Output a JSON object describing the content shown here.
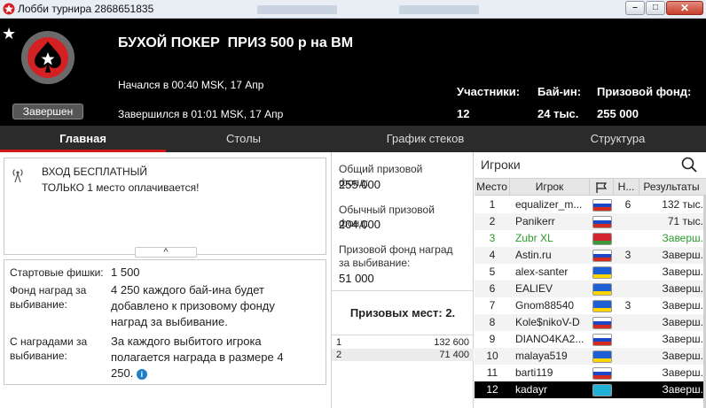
{
  "window": {
    "title": "Лобби турнира 2868651835",
    "controls": {
      "minimize": "–",
      "maximize": "□",
      "close": "✕"
    }
  },
  "header": {
    "star": "★",
    "status": "Завершен",
    "name": "БУХОЙ ПОКЕР  ПРИЗ 500 р на ВМ",
    "started": "Начался в 00:40 MSK, 17 Апр",
    "ended": "Завершился в 01:01 MSK, 17 Апр",
    "stats": [
      {
        "label": "Участники:",
        "value": "12"
      },
      {
        "label": "Бай-ин:",
        "value": "24 тыс."
      },
      {
        "label": "Призовой фонд:",
        "value": "255 000"
      }
    ]
  },
  "tabs": [
    {
      "label": "Главная",
      "active": true
    },
    {
      "label": "Столы",
      "active": false
    },
    {
      "label": "График стеков",
      "active": false
    },
    {
      "label": "Структура",
      "active": false
    }
  ],
  "promo": {
    "line1": "ВХОД БЕСПЛАТНЫЙ",
    "line2": "ТОЛЬКО 1 место оплачивается!",
    "collapse_glyph": "^"
  },
  "details": {
    "starting_chips_label": "Стартовые фишки:",
    "starting_chips_value": "1 500",
    "ko_fund_label_1": "Фонд наград за",
    "ko_fund_label_2": "выбивание:",
    "ko_fund_value_1": "4 250 каждого бай-ина будет",
    "ko_fund_value_2": "добавлено к призовому фонду",
    "ko_fund_value_3": "наград за выбивание.",
    "bounty_label_1": "С наградами за",
    "bounty_label_2": "выбивание:",
    "bounty_value_1": "За каждого выбитого игрока",
    "bounty_value_2": "полагается награда в размере 4",
    "bounty_value_3": "250.",
    "info_glyph": "i"
  },
  "prize_pool": {
    "total_label_1": "Общий призовой",
    "total_label_2": "фонд:",
    "total_value": "255 000",
    "regular_label_1": "Обычный призовой",
    "regular_label_2": "фонд:",
    "regular_value": "204 000",
    "ko_label_1": "Призовой фонд наград",
    "ko_label_2": "за выбивание:",
    "ko_value": "51 000",
    "places_title": "Призовых мест: 2.",
    "payouts": [
      {
        "place": "1",
        "amount": "132 600"
      },
      {
        "place": "2",
        "amount": "71 400"
      }
    ]
  },
  "players": {
    "title": "Игроки",
    "columns": {
      "place": "Место",
      "player": "Игрок",
      "knockouts": "Н...",
      "results": "Результаты"
    },
    "flag_colors": {
      "ru": [
        "#ffffff",
        "#1c46c8",
        "#d52b1e"
      ],
      "ua": [
        "#1f5fd6",
        "#1f5fd6",
        "#ffd500"
      ],
      "by": [
        "#d22730",
        "#d22730",
        "#3a9a3a"
      ],
      "kz": [
        "#20b2d6",
        "#20b2d6",
        "#20b2d6"
      ]
    },
    "rows": [
      {
        "place": "1",
        "name": "equalizer_m...",
        "flag": "ru",
        "knockouts": "6",
        "result": "132 тыс.",
        "style": ""
      },
      {
        "place": "2",
        "name": "Panikerr",
        "flag": "ru",
        "knockouts": "",
        "result": "71 тыс.",
        "style": ""
      },
      {
        "place": "3",
        "name": "Zubr XL",
        "flag": "by",
        "knockouts": "",
        "result": "Заверш.",
        "style": "green"
      },
      {
        "place": "4",
        "name": "Astin.ru",
        "flag": "ru",
        "knockouts": "3",
        "result": "Заверш.",
        "style": ""
      },
      {
        "place": "5",
        "name": "alex-santer",
        "flag": "ua",
        "knockouts": "",
        "result": "Заверш.",
        "style": ""
      },
      {
        "place": "6",
        "name": "EALIEV",
        "flag": "ua",
        "knockouts": "",
        "result": "Заверш.",
        "style": ""
      },
      {
        "place": "7",
        "name": "Gnom88540",
        "flag": "ua",
        "knockouts": "3",
        "result": "Заверш.",
        "style": ""
      },
      {
        "place": "8",
        "name": "Kole$nikoV-D",
        "flag": "ru",
        "knockouts": "",
        "result": "Заверш.",
        "style": ""
      },
      {
        "place": "9",
        "name": "DIANO4KA2...",
        "flag": "ru",
        "knockouts": "",
        "result": "Заверш.",
        "style": ""
      },
      {
        "place": "10",
        "name": "malaya519",
        "flag": "ua",
        "knockouts": "",
        "result": "Заверш.",
        "style": ""
      },
      {
        "place": "11",
        "name": "barti119",
        "flag": "ru",
        "knockouts": "",
        "result": "Заверш.",
        "style": ""
      },
      {
        "place": "12",
        "name": "kadayr",
        "flag": "kz",
        "knockouts": "",
        "result": "Заверш.",
        "style": "sel"
      }
    ]
  }
}
